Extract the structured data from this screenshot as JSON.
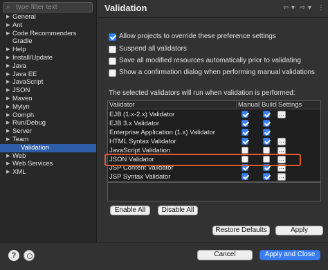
{
  "filter": {
    "placeholder": "type filter text"
  },
  "tree": [
    {
      "label": "General",
      "expandable": true
    },
    {
      "label": "Ant",
      "expandable": true
    },
    {
      "label": "Code Recommenders",
      "expandable": true
    },
    {
      "label": "Gradle",
      "expandable": false
    },
    {
      "label": "Help",
      "expandable": true
    },
    {
      "label": "Install/Update",
      "expandable": true
    },
    {
      "label": "Java",
      "expandable": true
    },
    {
      "label": "Java EE",
      "expandable": true
    },
    {
      "label": "JavaScript",
      "expandable": true
    },
    {
      "label": "JSON",
      "expandable": true
    },
    {
      "label": "Maven",
      "expandable": true
    },
    {
      "label": "Mylyn",
      "expandable": true
    },
    {
      "label": "Oomph",
      "expandable": true
    },
    {
      "label": "Run/Debug",
      "expandable": true
    },
    {
      "label": "Server",
      "expandable": true
    },
    {
      "label": "Team",
      "expandable": true
    },
    {
      "label": "Validation",
      "expandable": false,
      "selected": true
    },
    {
      "label": "Web",
      "expandable": true
    },
    {
      "label": "Web Services",
      "expandable": true
    },
    {
      "label": "XML",
      "expandable": true
    }
  ],
  "header": {
    "title": "Validation"
  },
  "options": [
    {
      "label": "Allow projects to override these preference settings",
      "checked": true
    },
    {
      "label": "Suspend all validators",
      "checked": false
    },
    {
      "label": "Save all modified resources automatically prior to validating",
      "checked": false
    },
    {
      "label": "Show a confirmation dialog when performing manual validations",
      "checked": false
    }
  ],
  "section_label": "The selected validators will run when validation is performed:",
  "table": {
    "columns": [
      "Validator",
      "Manual",
      "Build",
      "Settings"
    ],
    "rows": [
      {
        "name": "EJB (1.x-2.x) Validator",
        "manual": true,
        "build": true,
        "settings": true
      },
      {
        "name": "EJB 3.x Validator",
        "manual": true,
        "build": true,
        "settings": false
      },
      {
        "name": "Enterprise Application (1.x) Validator",
        "manual": true,
        "build": true,
        "settings": false
      },
      {
        "name": "HTML Syntax Validator",
        "manual": true,
        "build": true,
        "settings": true
      },
      {
        "name": "JavaScript Validation",
        "manual": false,
        "build": false,
        "settings": true
      },
      {
        "name": "JSON Validator",
        "manual": false,
        "build": false,
        "settings": true
      },
      {
        "name": "JSP Content Validator",
        "manual": true,
        "build": true,
        "settings": true
      },
      {
        "name": "JSP Syntax Validator",
        "manual": true,
        "build": true,
        "settings": true
      }
    ]
  },
  "buttons": {
    "enable_all": "Enable All",
    "disable_all": "Disable All",
    "restore_defaults": "Restore Defaults",
    "apply": "Apply",
    "cancel": "Cancel",
    "apply_and_close": "Apply and Close",
    "help": "?",
    "settings_dots": "..."
  },
  "colors": {
    "accent": "#3a7ef2",
    "selection": "#2f5ea8",
    "highlight": "#e05a2c"
  }
}
